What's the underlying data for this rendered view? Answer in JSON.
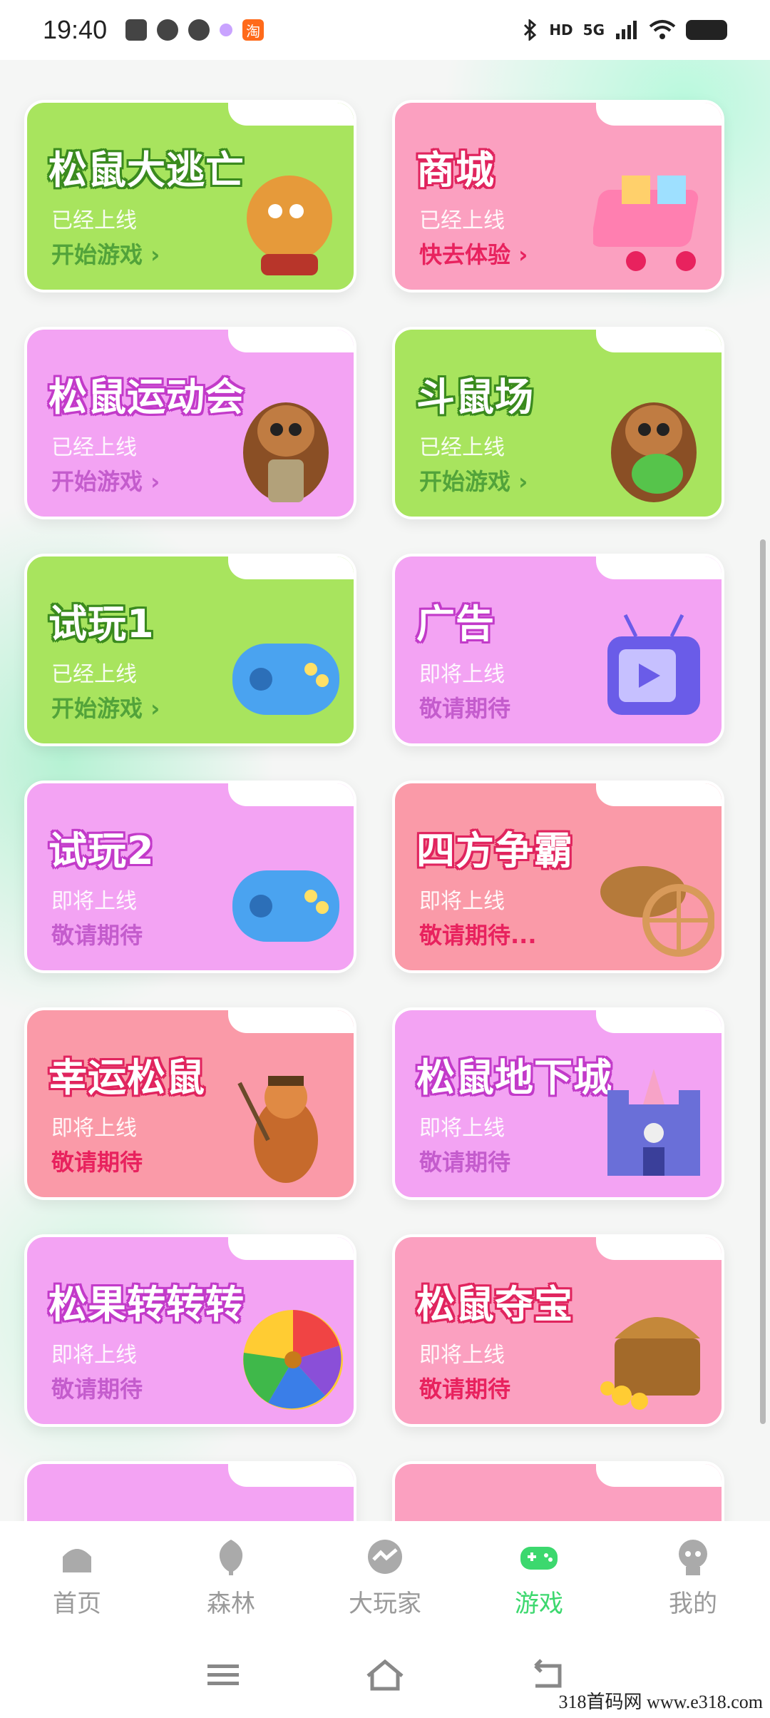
{
  "status_bar": {
    "time": "19:40",
    "right_text": "HD",
    "network": "5G"
  },
  "cards": [
    {
      "title": "松鼠大逃亡",
      "status": "已经上线",
      "action": "开始游戏 ›",
      "color": "green"
    },
    {
      "title": "商城",
      "status": "已经上线",
      "action": "快去体验 ›",
      "color": "pink"
    },
    {
      "title": "松鼠运动会",
      "status": "已经上线",
      "action": "开始游戏 ›",
      "color": "purple"
    },
    {
      "title": "斗鼠场",
      "status": "已经上线",
      "action": "开始游戏 ›",
      "color": "green"
    },
    {
      "title": "试玩1",
      "status": "已经上线",
      "action": "开始游戏 ›",
      "color": "green"
    },
    {
      "title": "广告",
      "status": "即将上线",
      "action": "敬请期待",
      "color": "purple"
    },
    {
      "title": "试玩2",
      "status": "即将上线",
      "action": "敬请期待",
      "color": "purple"
    },
    {
      "title": "四方争霸",
      "status": "即将上线",
      "action": "敬请期待...",
      "color": "pink"
    },
    {
      "title": "幸运松鼠",
      "status": "即将上线",
      "action": "敬请期待",
      "color": "pink"
    },
    {
      "title": "松鼠地下城",
      "status": "即将上线",
      "action": "敬请期待",
      "color": "purple"
    },
    {
      "title": "松果转转转",
      "status": "即将上线",
      "action": "敬请期待",
      "color": "purple"
    },
    {
      "title": "松鼠夺宝",
      "status": "即将上线",
      "action": "敬请期待",
      "color": "pink"
    }
  ],
  "nav": [
    {
      "label": "首页",
      "icon": "home-icon"
    },
    {
      "label": "森林",
      "icon": "forest-icon"
    },
    {
      "label": "大玩家",
      "icon": "player-icon"
    },
    {
      "label": "游戏",
      "icon": "gamepad-icon",
      "active": true
    },
    {
      "label": "我的",
      "icon": "profile-icon"
    }
  ],
  "watermark": "318首码网 www.e318.com",
  "colors": {
    "accent": "#3cd86e",
    "green_card": "#a8e45e",
    "pink_card": "#fba0c0",
    "purple_card": "#f3a3f3"
  }
}
